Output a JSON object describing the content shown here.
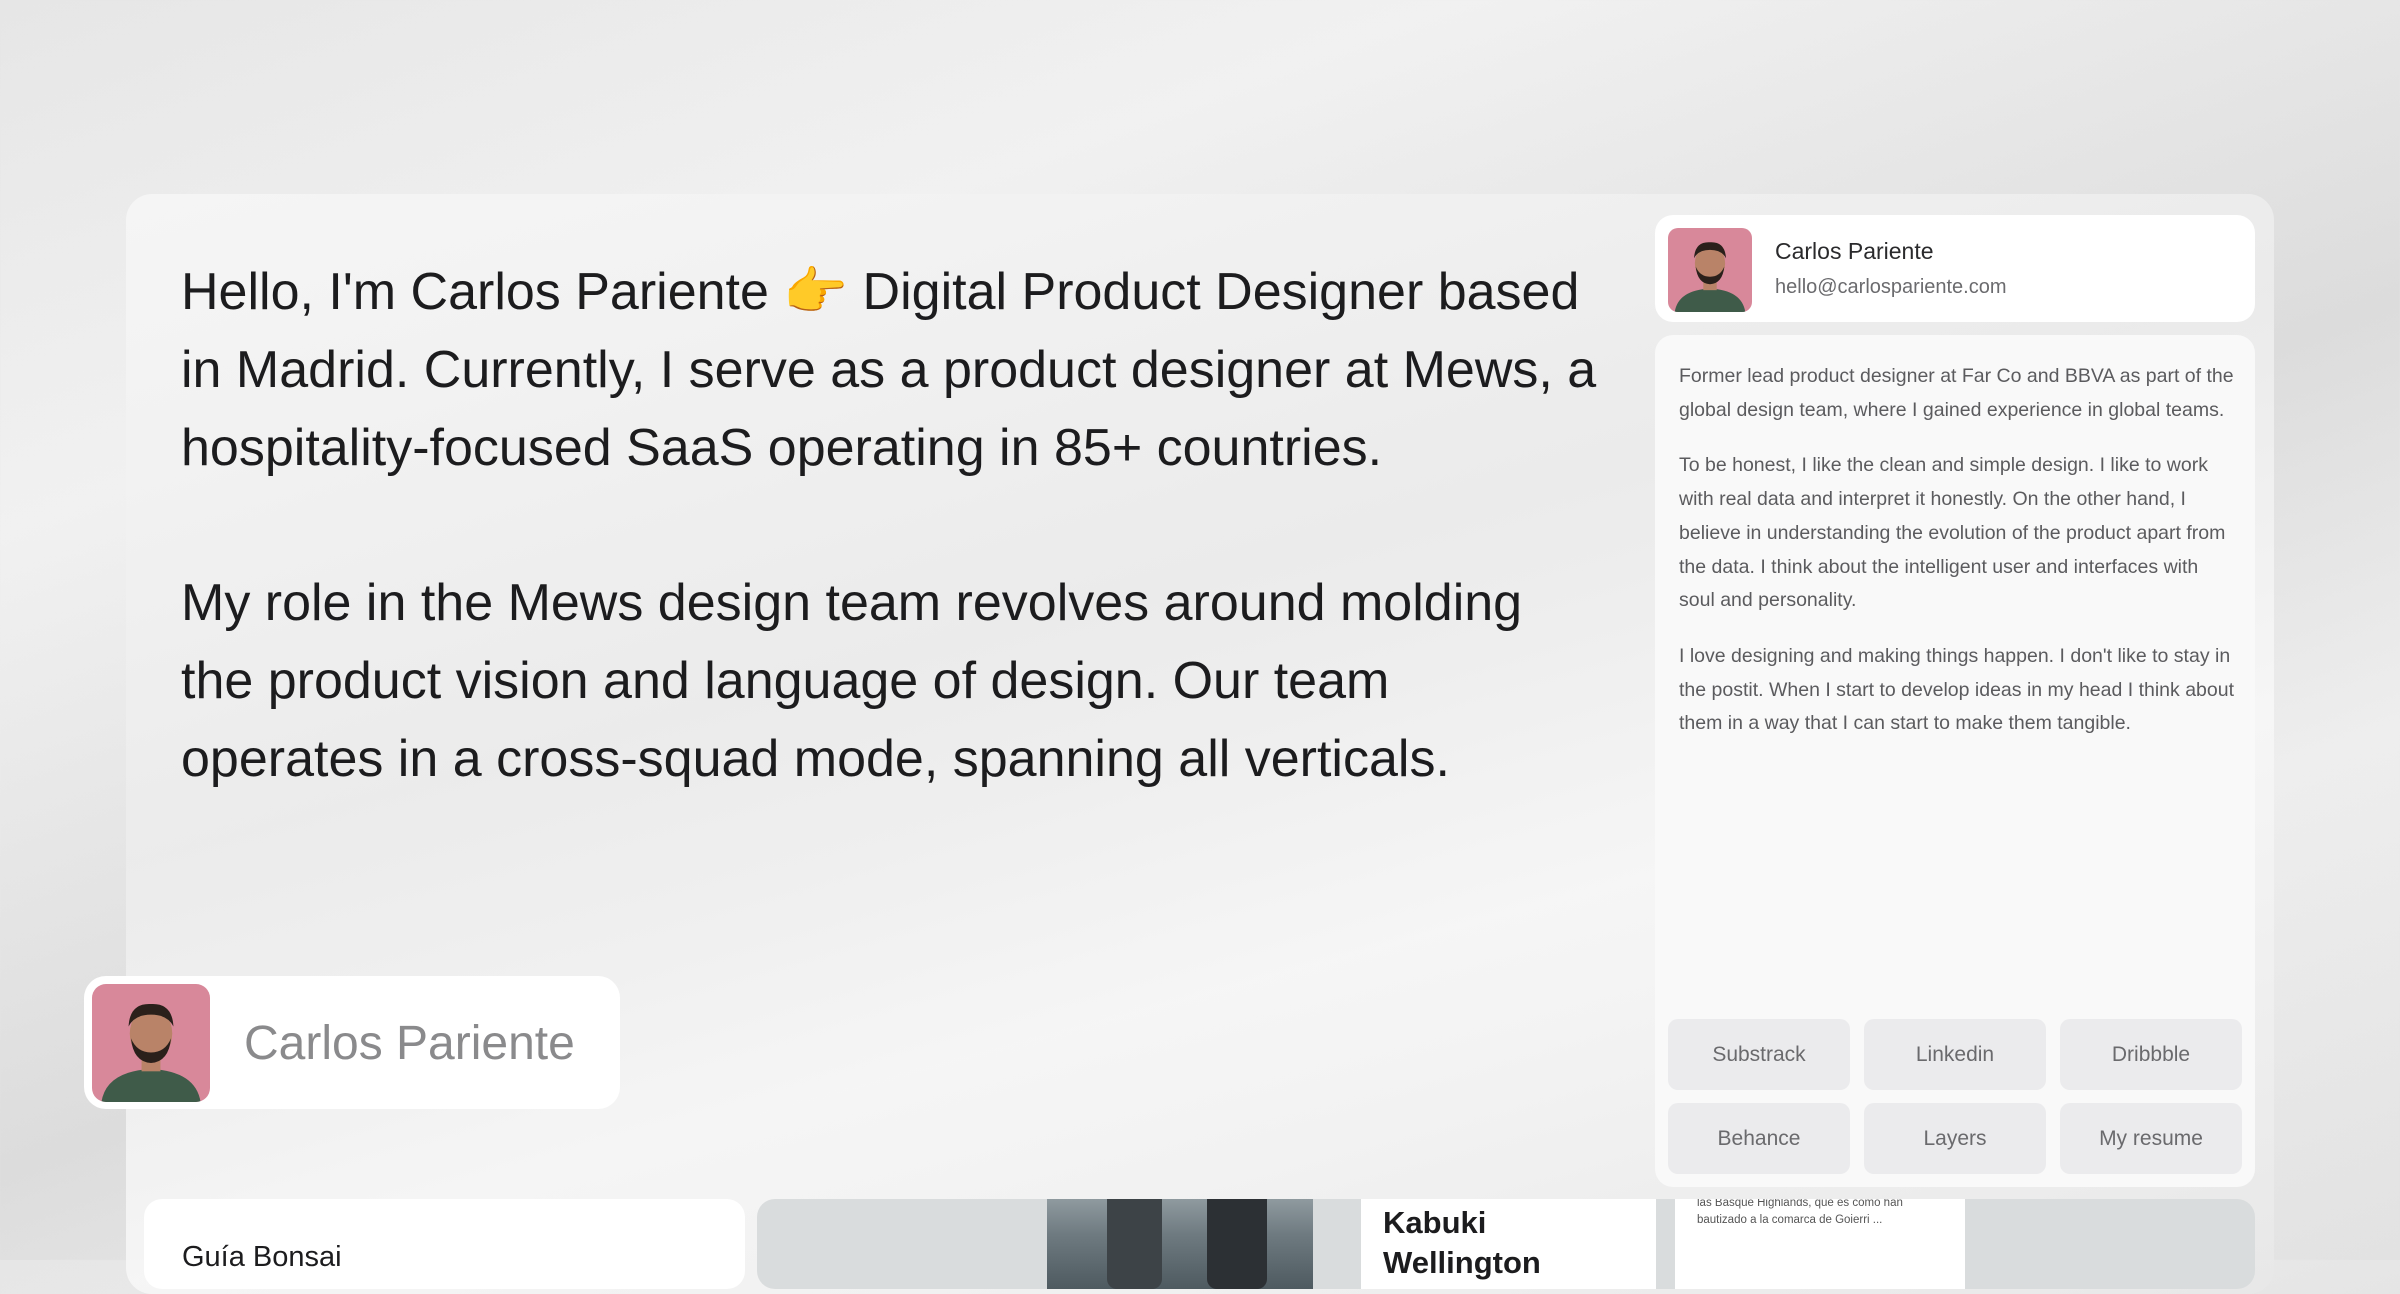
{
  "intro": {
    "paragraph1": "Hello, I'm Carlos Pariente 👉 Digital Product Designer based in Madrid. Currently, I serve as a product designer at Mews, a hospitality-focused SaaS operating in 85+ countries.",
    "paragraph2": "My role in the Mews design team revolves around molding the product vision and language of design. Our team operates in a cross-squad mode, spanning all verticals."
  },
  "badge": {
    "name": "Carlos Pariente",
    "avatar_icon": "person-avatar-icon"
  },
  "profile": {
    "name": "Carlos Pariente",
    "email": "hello@carlospariente.com",
    "bio": [
      "Former lead product designer at Far Co and BBVA as part of the global design team, where I gained experience in global teams.",
      "To be honest, I like the clean and simple design. I like to work with real data and interpret it honestly. On the other hand, I believe in understanding the evolution of the product apart from the data. I think about the intelligent user and interfaces with soul and personality.",
      "I love designing and making things happen. I don't like to stay in the postit. When I start to develop ideas in my head I think about them in a way that I can start to make them tangible."
    ],
    "links": [
      "Substrack",
      "Linkedin",
      "Dribbble",
      "Behance",
      "Layers",
      "My resume"
    ]
  },
  "projects": {
    "guia_title": "Guía Bonsai",
    "kabuki_title": "Kabuki Wellington",
    "snippet_text": "las Basque Highlands, que es como han bautizado a la comarca de Goierri ..."
  },
  "colors": {
    "avatar_background": "#d8889a",
    "avatar_shirt": "#3f5b49",
    "avatar_skin": "#b98368",
    "avatar_hair": "#2a201b"
  }
}
